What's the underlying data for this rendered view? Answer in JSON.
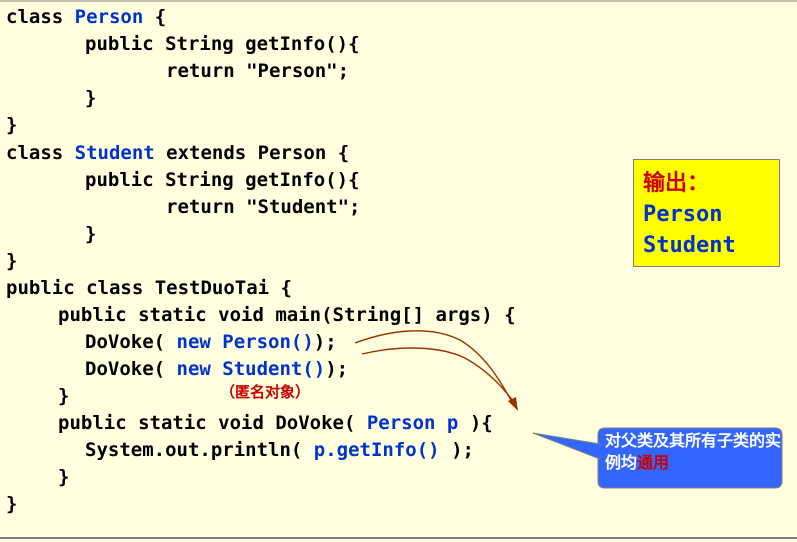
{
  "code": {
    "l1": [
      "class ",
      "Person",
      " {"
    ],
    "l2": "public String getInfo(){",
    "l3": "return \"Person\";",
    "l4": "}",
    "l5": "}",
    "l6": [
      "class ",
      "Student",
      " extends Person {"
    ],
    "l7": "public String getInfo(){",
    "l8": "return \"Student\";",
    "l9": "}",
    "l10": "}",
    "l11": "public class TestDuoTai {",
    "l12": "public static void main(String[] args) {",
    "l13": [
      "DoVoke( ",
      "new Person()",
      ");"
    ],
    "l14": [
      "DoVoke( ",
      "new Student()",
      ");"
    ],
    "l15": "}",
    "l16": [
      "public static void DoVoke( ",
      "Person p",
      " ){"
    ],
    "l17": [
      "System.out.println( ",
      "p.getInfo()",
      " );"
    ],
    "l18": "}",
    "l19": "}"
  },
  "anonymous_note": "（匿名对象）",
  "output": {
    "title": "输出：",
    "lines": [
      "Person",
      "Student"
    ]
  },
  "callout": {
    "text_before": "对父类及其所有子类的实例均",
    "text_highlight": "通用"
  },
  "colors": {
    "background": "#FFFFE0",
    "keyword_blue": "#0033CC",
    "output_box": "#FFFF00",
    "callout_fill": "#3366FF",
    "annotation_red": "#CC0000",
    "arrow": "#993300"
  }
}
